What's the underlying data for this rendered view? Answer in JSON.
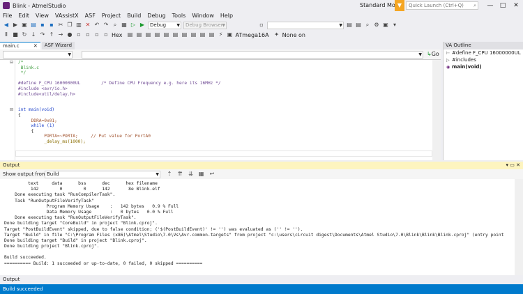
{
  "window": {
    "title": "Blink - AtmelStudio",
    "mode": "Standard Mode",
    "quick_launch_placeholder": "Quick Launch (Ctrl+Q)",
    "minimize": "—",
    "maximize": "□",
    "close": "✕"
  },
  "menu": [
    "File",
    "Edit",
    "View",
    "VAssistX",
    "ASF",
    "Project",
    "Build",
    "Debug",
    "Tools",
    "Window",
    "Help"
  ],
  "toolbar1": {
    "config": "Debug",
    "debug_browser": "Debug Browser"
  },
  "toolbar2": {
    "hex": "Hex",
    "device": "ATmega16A",
    "tool": "None on"
  },
  "editor": {
    "tabs": [
      {
        "label": "main.c",
        "close": "✕"
      },
      {
        "label": "ASF Wizard"
      }
    ],
    "go_label": "Go",
    "lines": [
      "/*",
      " Blink.c",
      " */",
      "",
      "#define F_CPU 16000000UL        /* Define CPU Frequency e.g. here its 16MHz */",
      "#include <avr/io.h>",
      "#include<util/delay.h>",
      "",
      "",
      "int main(void)",
      "{",
      "     DDRA=0x01;",
      "     while (1)",
      "     {",
      "          PORTA=~PORTA;     // Put value for PortA0",
      "          _delay_ms(1000);"
    ]
  },
  "va_outline": {
    "title": "VA Outline",
    "items": [
      {
        "label": "#define F_CPU 16000000UL",
        "icon": "define-icon"
      },
      {
        "label": "#includes",
        "icon": "include-icon"
      },
      {
        "label": "main(void)",
        "icon": "function-icon"
      }
    ]
  },
  "output": {
    "title": "Output",
    "show_from_label": "Show output from:",
    "source": "Build",
    "lines": [
      "         text     data      bss      dec      hex filename",
      "          142        0        0      142       8e Blink.elf",
      "    Done executing task \"RunCompilerTask\".",
      "    Task \"RunOutputFileVerifyTask\"",
      "                Program Memory Usage    :   142 bytes   0.9 % Full",
      "                Data Memory Usage       :   0 bytes   0.0 % Full",
      "    Done executing task \"RunOutputFileVerifyTask\".",
      "Done building target \"CoreBuild\" in project \"Blink.cproj\".",
      "Target \"PostBuildEvent\" skipped, due to false condition; ('$(PostBuildEvent)' != '') was evaluated as ('' != '').",
      "Target \"Build\" in file \"C:\\Program Files (x86)\\Atmel\\Studio\\7.0\\Vs\\Avr.common.targets\" from project \"c:\\users\\circuit digest\\Documents\\Atmel Studio\\7.0\\Blink\\Blink\\Blink.cproj\" (entry point",
      "Done building target \"Build\" in project \"Blink.cproj\".",
      "Done building project \"Blink.cproj\".",
      "",
      "Build succeeded.",
      "========== Build: 1 succeeded or up-to-date, 0 failed, 0 skipped =========="
    ],
    "bottom_tab": "Output"
  },
  "status": "Build succeeded"
}
